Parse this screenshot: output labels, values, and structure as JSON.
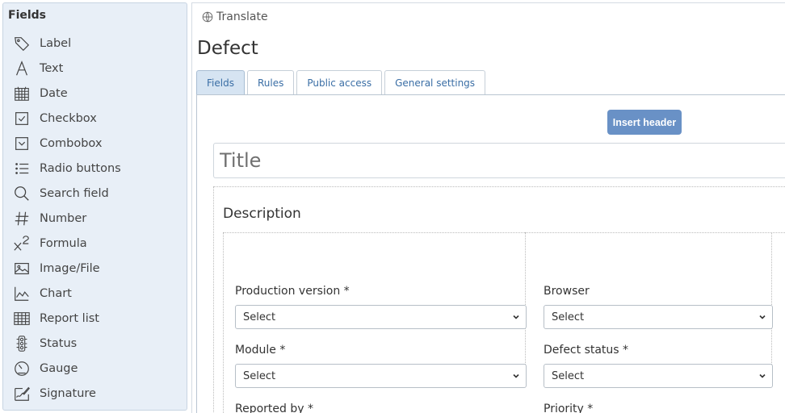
{
  "sidebar": {
    "title": "Fields",
    "items": [
      {
        "label": "Label",
        "icon": "tag-icon"
      },
      {
        "label": "Text",
        "icon": "text-icon"
      },
      {
        "label": "Date",
        "icon": "calendar-icon"
      },
      {
        "label": "Checkbox",
        "icon": "checkbox-icon"
      },
      {
        "label": "Combobox",
        "icon": "combobox-icon"
      },
      {
        "label": "Radio buttons",
        "icon": "list-icon"
      },
      {
        "label": "Search field",
        "icon": "search-icon"
      },
      {
        "label": "Number",
        "icon": "hash-icon"
      },
      {
        "label": "Formula",
        "icon": "formula-icon"
      },
      {
        "label": "Image/File",
        "icon": "image-icon"
      },
      {
        "label": "Chart",
        "icon": "chart-icon"
      },
      {
        "label": "Report list",
        "icon": "table-icon"
      },
      {
        "label": "Status",
        "icon": "traffic-light-icon"
      },
      {
        "label": "Gauge",
        "icon": "gauge-icon"
      },
      {
        "label": "Signature",
        "icon": "signature-icon"
      }
    ]
  },
  "header": {
    "translate_label": "Translate",
    "page_title": "Defect"
  },
  "tabs": [
    {
      "label": "Fields",
      "active": true
    },
    {
      "label": "Rules",
      "active": false
    },
    {
      "label": "Public access",
      "active": false
    },
    {
      "label": "General settings",
      "active": false
    }
  ],
  "form": {
    "insert_header_label": "Insert header",
    "title_placeholder": "Title",
    "section_title": "Description",
    "fields": [
      {
        "label": "Production version  *",
        "value": "Select"
      },
      {
        "label": "Browser",
        "value": "Select"
      },
      {
        "label": "Module  *",
        "value": "Select"
      },
      {
        "label": "Defect status  *",
        "value": "Select"
      },
      {
        "label": "Reported by  *"
      },
      {
        "label": "Priority  *"
      }
    ]
  },
  "colors": {
    "sidebar_bg": "#e8eff7",
    "active_tab_bg": "#d6e4f2",
    "link_text": "#3a6ea5",
    "primary_button": "#6991c6"
  }
}
